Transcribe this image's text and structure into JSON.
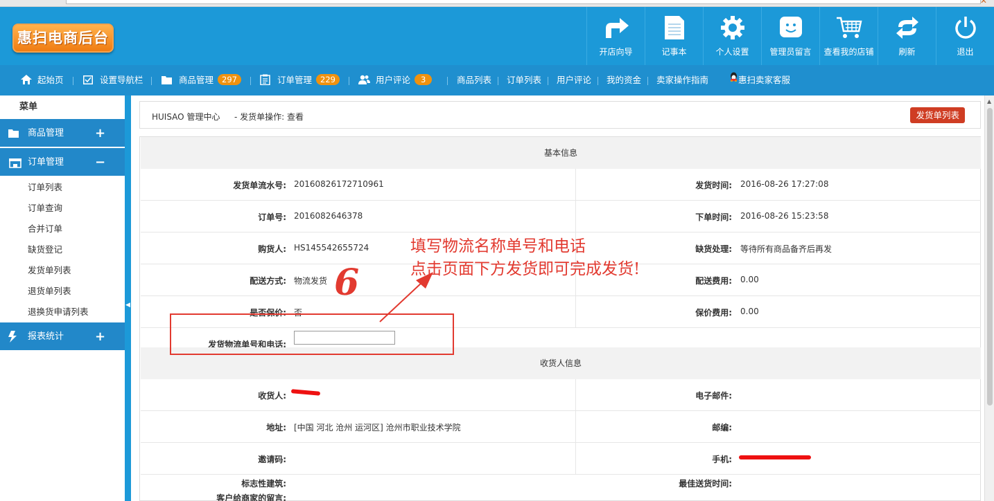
{
  "header": {
    "logo": "惠扫电商后台",
    "tools": [
      {
        "label": "开店向导",
        "icon": "share-arrow-icon"
      },
      {
        "label": "记事本",
        "icon": "notepad-icon"
      },
      {
        "label": "个人设置",
        "icon": "gear-icon"
      },
      {
        "label": "管理员留言",
        "icon": "chat-icon"
      },
      {
        "label": "查看我的店铺",
        "icon": "cart-icon"
      },
      {
        "label": "刷新",
        "icon": "refresh-icon"
      },
      {
        "label": "退出",
        "icon": "power-icon"
      }
    ]
  },
  "nav": {
    "home": "起始页",
    "set_nav": "设置导航栏",
    "goods_mgmt": "商品管理",
    "goods_count": "297",
    "order_mgmt": "订单管理",
    "order_count": "229",
    "user_comments": "用户评论",
    "comment_count": "3",
    "goods_list": "商品列表",
    "order_list": "订单列表",
    "user_review": "用户评论",
    "my_funds": "我的资金",
    "seller_guide": "卖家操作指南",
    "service": "惠扫卖家客服"
  },
  "sidebar": {
    "title": "菜单",
    "groups": [
      {
        "label": "商品管理",
        "sign": "+"
      },
      {
        "label": "订单管理",
        "sign": "−"
      },
      {
        "label": "报表统计",
        "sign": "+"
      }
    ],
    "order_items": [
      "订单列表",
      "订单查询",
      "合并订单",
      "缺货登记",
      "发货单列表",
      "退货单列表",
      "退换货申请列表"
    ]
  },
  "breadcrumb": {
    "center": "HUISAO 管理中心",
    "action": "- 发货单操作: 查看",
    "list_button": "发货单列表"
  },
  "basic": {
    "title": "基本信息",
    "rows": [
      {
        "l1": "发货单流水号:",
        "v1": "20160826172710961",
        "l2": "发货时间:",
        "v2": "2016-08-26 17:27:08"
      },
      {
        "l1": "订单号:",
        "v1": "2016082646378",
        "l2": "下单时间:",
        "v2": "2016-08-26 15:23:58"
      },
      {
        "l1": "购货人:",
        "v1": "HS145542655724",
        "l2": "缺货处理:",
        "v2": "等待所有商品备齐后再发"
      },
      {
        "l1": "配送方式:",
        "v1": "物流发货",
        "l2": "配送费用:",
        "v2": "0.00"
      },
      {
        "l1": "是否保价:",
        "v1": "否",
        "l2": "保价费用:",
        "v2": "0.00"
      }
    ],
    "tracking_label": "发货物流单号和电话:",
    "tracking_value": ""
  },
  "consignee": {
    "title": "收货人信息",
    "rows": [
      {
        "l1": "收货人:",
        "v1": "",
        "l2": "电子邮件:",
        "v2": ""
      },
      {
        "l1": "地址:",
        "v1": "[中国 河北 沧州 运河区] 沧州市职业技术学院",
        "l2": "邮编:",
        "v2": ""
      },
      {
        "l1": "邀请码:",
        "v1": "",
        "l2": "手机:",
        "v2": ""
      },
      {
        "l1": "标志性建筑:",
        "v1": "",
        "l2": "最佳送货时间:",
        "v2": ""
      },
      {
        "l1": "客户给商家的留言:",
        "v1": "",
        "l2": "",
        "v2": ""
      }
    ]
  },
  "annotation": {
    "line1": "填写物流名称单号和电话",
    "line2": "点击页面下方发货即可完成发货!",
    "step": "6"
  },
  "colors": {
    "header": "#1c99d8",
    "navbar": "#1f8fcf",
    "accent_orange": "#f0920f",
    "button_red": "#cf3d23",
    "annotation_red": "#e23a30"
  }
}
